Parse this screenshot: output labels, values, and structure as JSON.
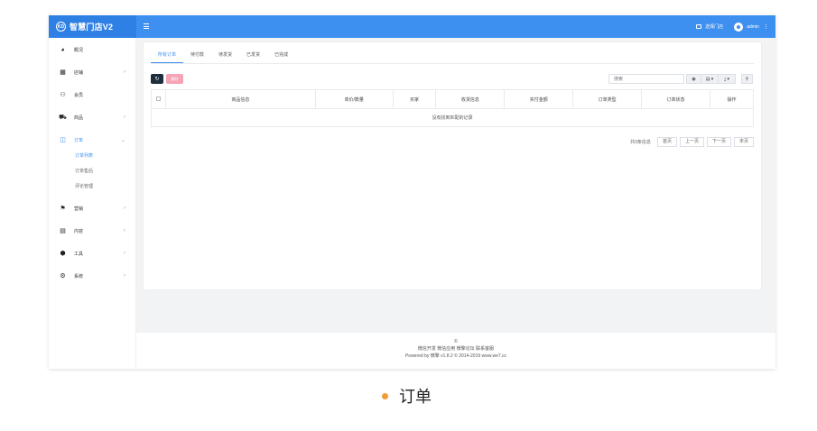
{
  "app": {
    "title": "智慧门店V2",
    "logo_text": "KD",
    "accent_color": "#3d8ff0"
  },
  "topbar": {
    "store_label": "选择门店",
    "user_name": "admin"
  },
  "sidebar": {
    "items": [
      {
        "label": "概况",
        "icon": "dashboard-icon",
        "glyph": "◕",
        "arrow": ""
      },
      {
        "label": "店铺",
        "icon": "grid-icon",
        "glyph": "▦",
        "arrow": "›"
      },
      {
        "label": "会员",
        "icon": "users-icon",
        "glyph": "⚇",
        "arrow": ""
      },
      {
        "label": "商品",
        "icon": "cart-icon",
        "glyph": "⛟",
        "arrow": "›"
      },
      {
        "label": "订单",
        "icon": "order-icon",
        "glyph": "◫",
        "arrow": "⌄"
      },
      {
        "label": "营销",
        "icon": "flag-icon",
        "glyph": "⚑",
        "arrow": "›"
      },
      {
        "label": "内容",
        "icon": "file-icon",
        "glyph": "▤",
        "arrow": "›"
      },
      {
        "label": "工具",
        "icon": "box-icon",
        "glyph": "⬢",
        "arrow": "›"
      },
      {
        "label": "系统",
        "icon": "gear-icon",
        "glyph": "⚙",
        "arrow": "›"
      }
    ],
    "subitems": [
      {
        "label": "订单列表"
      },
      {
        "label": "订单售后"
      },
      {
        "label": "评论管理"
      }
    ]
  },
  "tabs": [
    {
      "label": "所有订单"
    },
    {
      "label": "待付款"
    },
    {
      "label": "待发货"
    },
    {
      "label": "已发货"
    },
    {
      "label": "已完成"
    }
  ],
  "toolbar": {
    "refresh_glyph": "↻",
    "delete_label": "删除",
    "search_placeholder": "搜索",
    "eye_glyph": "◉",
    "columns_glyph": "▤ ▾",
    "export_glyph": "⤓ ▾",
    "search_glyph": "⚲"
  },
  "table": {
    "columns": [
      "商品信息",
      "单价/数量",
      "买家",
      "收货信息",
      "实付金额",
      "订单类型",
      "订单状态",
      "操作"
    ],
    "empty_text": "没有找到匹配的记录"
  },
  "pager": {
    "total": "共0条信息",
    "first": "首页",
    "prev": "上一页",
    "next": "下一页",
    "last": "末页"
  },
  "footer": {
    "line1": "©",
    "line2": "微信开发 微信应用 微擎论坛 联系客服",
    "line3": "Powered by 微擎 v1.8.2 © 2014-2019 www.we7.cc"
  },
  "caption": {
    "text": "订单"
  }
}
